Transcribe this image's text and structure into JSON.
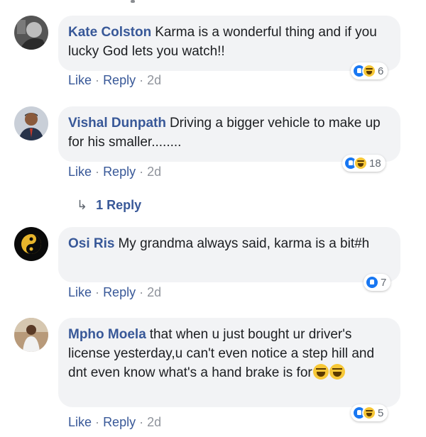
{
  "comments": [
    {
      "author": "Kate Colston",
      "text": "Karma is a wonderful thing and if you lucky God lets you watch!!",
      "like": "Like",
      "reply": "Reply",
      "age": "2d",
      "reaction_count": "6",
      "reaction_icons": [
        "like-icon",
        "haha-icon"
      ]
    },
    {
      "author": "Vishal Dunpath",
      "text": "Driving a bigger vehicle to make up for his smaller........",
      "like": "Like",
      "reply": "Reply",
      "age": "2d",
      "reaction_count": "18",
      "reaction_icons": [
        "like-icon",
        "haha-icon"
      ],
      "replies_label": "1 Reply"
    },
    {
      "author": "Osi Ris",
      "text": "My grandma always said, karma is a bit#h",
      "like": "Like",
      "reply": "Reply",
      "age": "2d",
      "reaction_count": "7",
      "reaction_icons": [
        "like-icon"
      ]
    },
    {
      "author": "Mpho Moela",
      "text": "that when u just bought ur driver's license yesterday,u can't even notice a step hill and dnt even know what's a hand brake is for",
      "like": "Like",
      "reply": "Reply",
      "age": "2d",
      "reaction_count": "5",
      "reaction_icons": [
        "like-icon",
        "haha-icon"
      ],
      "trailing_emojis": [
        "laughing-tears-emoji",
        "laughing-tears-emoji"
      ]
    }
  ],
  "separator": "·",
  "colors": {
    "link": "#385898",
    "bubble": "#f2f3f5",
    "meta": "#90949c",
    "like_blue": "#1877f2"
  }
}
